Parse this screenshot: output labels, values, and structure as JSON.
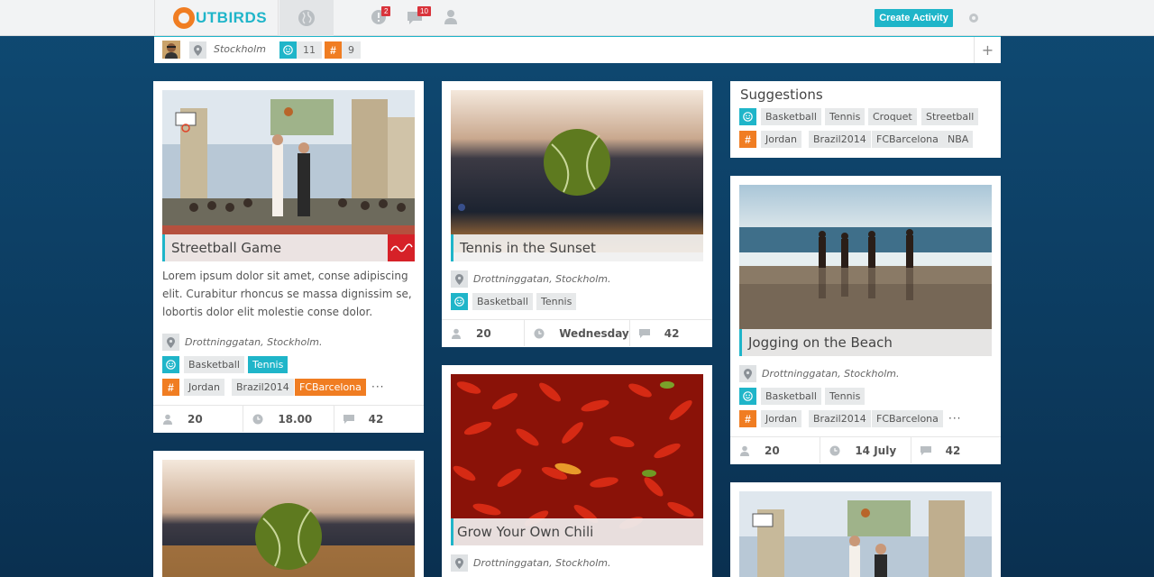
{
  "brand": {
    "name": "UTBIRDS"
  },
  "nav": {
    "alerts_badge": "2",
    "messages_badge": "10",
    "create_label": "Create Activity"
  },
  "subbar": {
    "location": "Stockholm",
    "interests_count": "11",
    "tags_count": "9"
  },
  "cards": {
    "streetball": {
      "title": "Streetball Game",
      "description": "Lorem ipsum dolor sit amet, conse adipiscing elit. Curabitur rhoncus se massa dignissim se, lobortis dolor elit molestie conse dolor.",
      "location": "Drottninggatan, Stockholm.",
      "interests": [
        "Basketball",
        "Tennis"
      ],
      "tags": [
        "Jordan",
        "Brazil2014",
        "FCBarcelona"
      ],
      "more": "···",
      "participants": "20",
      "time": "18.00",
      "comments": "42"
    },
    "tennis": {
      "title": "Tennis in the Sunset",
      "location": "Drottninggatan, Stockholm.",
      "interests": [
        "Basketball",
        "Tennis"
      ],
      "participants": "20",
      "time": "Wednesday",
      "comments": "42"
    },
    "chili": {
      "title": "Grow Your Own Chili",
      "location": "Drottninggatan, Stockholm."
    },
    "jogging": {
      "title": "Jogging on the Beach",
      "location": "Drottninggatan, Stockholm.",
      "interests": [
        "Basketball",
        "Tennis"
      ],
      "tags": [
        "Jordan",
        "Brazil2014",
        "FCBarcelona"
      ],
      "more": "···",
      "participants": "20",
      "time": "14 July",
      "comments": "42"
    }
  },
  "suggestions": {
    "title": "Suggestions",
    "interests": [
      "Basketball",
      "Tennis",
      "Croquet",
      "Streetball"
    ],
    "tags": [
      "Jordan",
      "Brazil2014",
      "FCBarcelona",
      "NBA"
    ]
  },
  "colors": {
    "accent": "#1fb5c9",
    "tag_orange": "#f07d22",
    "badge_red": "#d9333b"
  }
}
